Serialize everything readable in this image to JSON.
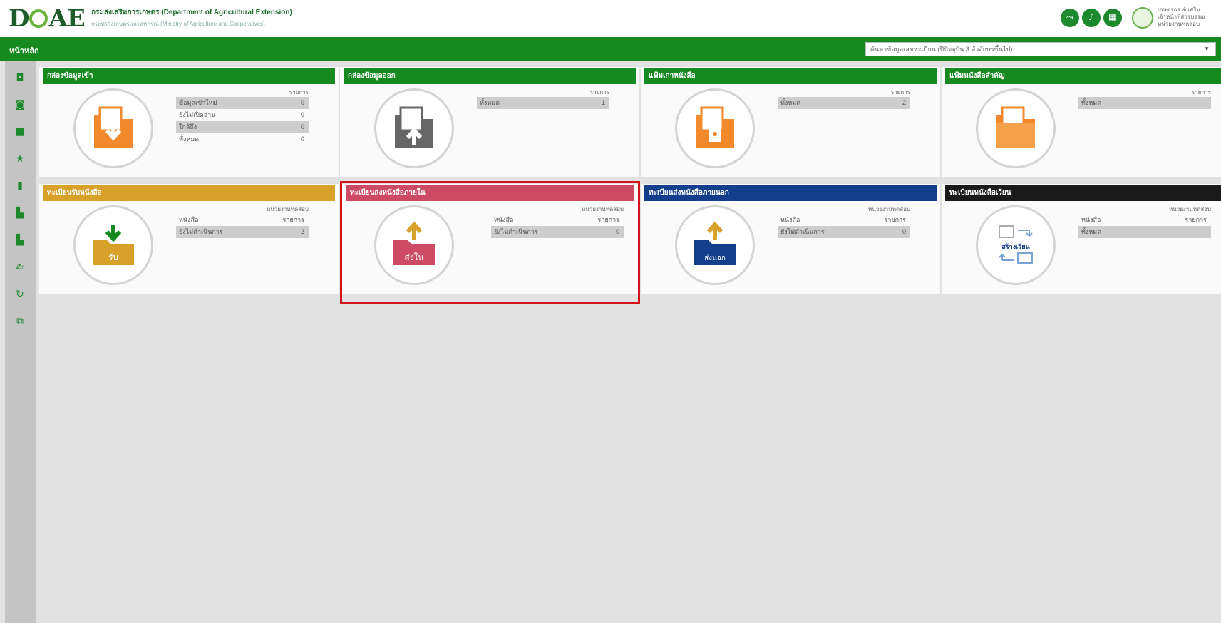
{
  "header": {
    "logo_text": "DOAE",
    "org_name": "กรมส่งเสริมการเกษตร (Department of Agricultural Extension)",
    "org_sub": "กระทรวงเกษตรและสหกรณ์ (Ministry of Agriculture and Cooperatives)",
    "user_line1": "เกษตรกร ส่งเสริม",
    "user_line2": "เจ้าหน้าที่สารบรรณ",
    "user_line3": "หน่วยงานทดสอบ",
    "icons": [
      "share-icon",
      "bell-icon",
      "apps-grid-icon",
      "emblem-icon"
    ]
  },
  "nav": {
    "home_label": "หน้าหลัก",
    "search_placeholder": "ค้นหาข้อมูลเลขทะเบียน (ปีปัจจุบัน 3 ตัวอักษรขึ้นไป)"
  },
  "sidebar": {
    "icons": [
      "inbox-icon",
      "outbox-icon",
      "folder-icon",
      "star-icon",
      "trash-icon",
      "file-icon",
      "file-alt-icon",
      "signature-icon",
      "refresh-icon",
      "external-link-icon"
    ]
  },
  "panels": [
    {
      "title": "กล่องข้อมูลเข้า",
      "color": "#168a1e",
      "col_header": "รายการ",
      "rows": [
        {
          "label": "ข้อมูลเข้าใหม่",
          "value": "0",
          "shaded": true
        },
        {
          "label": "ยังไม่เปิดอ่าน",
          "value": "0",
          "shaded": false
        },
        {
          "label": "ใกล้ถึง",
          "value": "0",
          "shaded": true
        },
        {
          "label": "ทั้งหมด",
          "value": "0",
          "shaded": false
        }
      ]
    },
    {
      "title": "กล่องข้อมูลออก",
      "color": "#168a1e",
      "col_header": "รายการ",
      "rows": [
        {
          "label": "ทั้งหมด",
          "value": "1",
          "shaded": true
        }
      ]
    },
    {
      "title": "แฟ้มเก่าหนังสือ",
      "color": "#168a1e",
      "col_header": "รายการ",
      "rows": [
        {
          "label": "ทั้งหมด",
          "value": "2",
          "shaded": true
        }
      ]
    },
    {
      "title": "แฟ้มหนังสือสำคัญ",
      "color": "#168a1e",
      "col_header": "รายการ",
      "rows": [
        {
          "label": "ทั้งหมด",
          "value": "",
          "shaded": true
        }
      ]
    },
    {
      "title": "ทะเบียนรับหนังสือ",
      "color": "#d8a12a",
      "unit": "หน่วยงานทดสอบ",
      "col_left": "หนังสือ",
      "col_right": "รายการ",
      "rows": [
        {
          "label": "ยังไม่ดำเนินการ",
          "value": "2",
          "shaded": true
        }
      ],
      "icon_caption": "รับ"
    },
    {
      "title": "ทะเบียนส่งหนังสือภายใน",
      "color": "#cc4a63",
      "unit": "หน่วยงานทดสอบ",
      "col_left": "หนังสือ",
      "col_right": "รายการ",
      "rows": [
        {
          "label": "ยังไม่ดำเนินการ",
          "value": "0",
          "shaded": true
        }
      ],
      "icon_caption": "ส่งใน"
    },
    {
      "title": "ทะเบียนส่งหนังสือภายนอก",
      "color": "#123e8c",
      "unit": "หน่วยงานทดสอบ",
      "col_left": "หนังสือ",
      "col_right": "รายการ",
      "rows": [
        {
          "label": "ยังไม่ดำเนินการ",
          "value": "0",
          "shaded": true
        }
      ],
      "icon_caption": "ส่งนอก"
    },
    {
      "title": "ทะเบียนหนังสือเวียน",
      "color": "#1a1a1a",
      "unit": "หน่วยงานทดสอบ",
      "col_left": "หนังสือ",
      "col_right": "รายการ",
      "rows": [
        {
          "label": "ทั้งหมด",
          "value": "",
          "shaded": true
        }
      ],
      "icon_caption": "สร้างเวียน"
    }
  ]
}
